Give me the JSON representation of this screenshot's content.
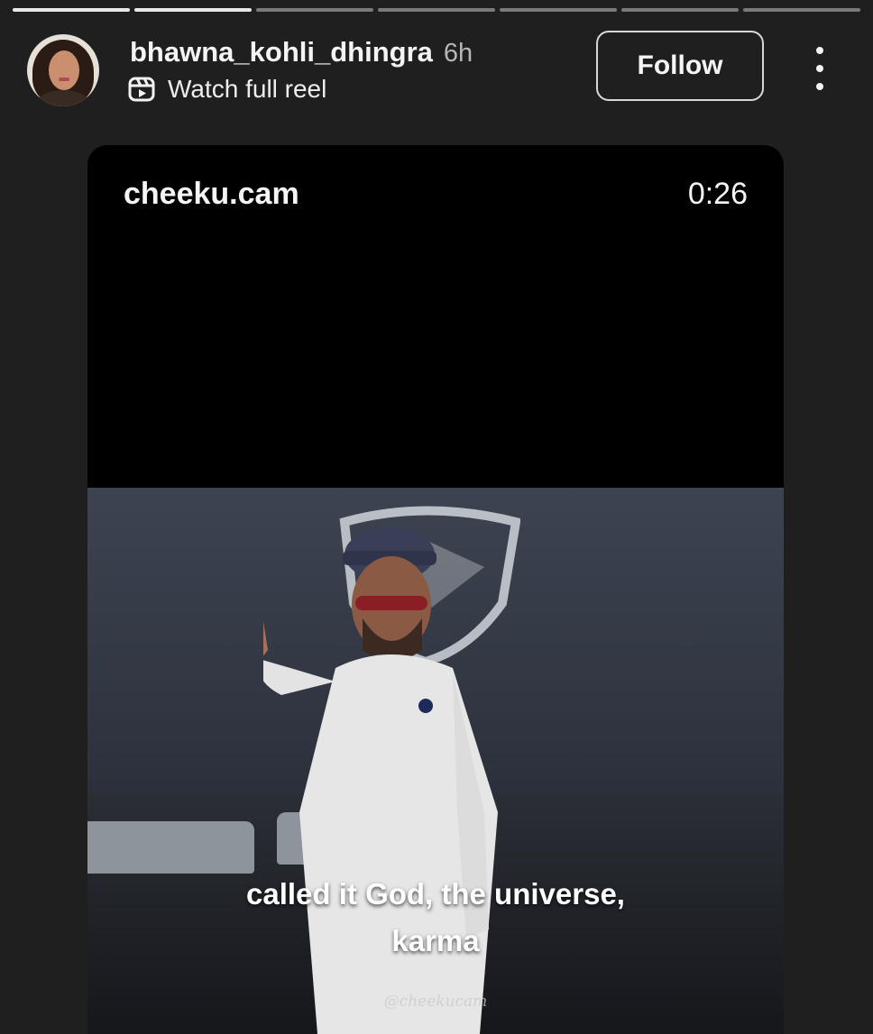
{
  "story": {
    "segments": 7,
    "completed_segments": 2
  },
  "header": {
    "username": "bhawna_kohli_dhingra",
    "time_ago": "6h",
    "reel_link_label": "Watch full reel",
    "follow_label": "Follow",
    "more_icon": "more-vertical-icon",
    "reel_icon": "reels-icon"
  },
  "reel": {
    "channel_name": "cheeku.cam",
    "duration": "0:26",
    "caption_line1": "called it God, the universe,",
    "caption_line2": "karma",
    "watermark": "@cheekucam"
  },
  "colors": {
    "background": "#1f1f1f",
    "card": "#000000",
    "text": "#f5f5f5"
  }
}
